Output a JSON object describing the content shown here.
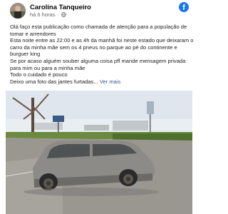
{
  "post": {
    "author": "Carolina Tanqueiro",
    "time": "há 6 horas",
    "lines": [
      "Olá faço esta publicação como chamada de atenção para a população de tomar e arrendores",
      "Esta noite entre as 22:00 e as 4h da manhã foi neste estado que deixaram o carro da minha mãe sem os 4 pneus no parque ao pé do continente e burguer king",
      "Se por acaso alguém souber alguma coisa pff mande mensagem privada para mim ou para a minha mãe",
      "Todo o cuidado é pouco"
    ],
    "last_line": "Deixo uma foto das jantes furtadas...",
    "see_more": "Ver mais"
  },
  "photo": {
    "description_icon": "car-photo",
    "colors": {
      "sky": "#e9eef3",
      "car": "#8d8b88",
      "asphalt": "#9a9791",
      "grass": "#4f6f2c"
    }
  },
  "brand": {
    "icon": "facebook-icon",
    "color": "#1877f2"
  }
}
